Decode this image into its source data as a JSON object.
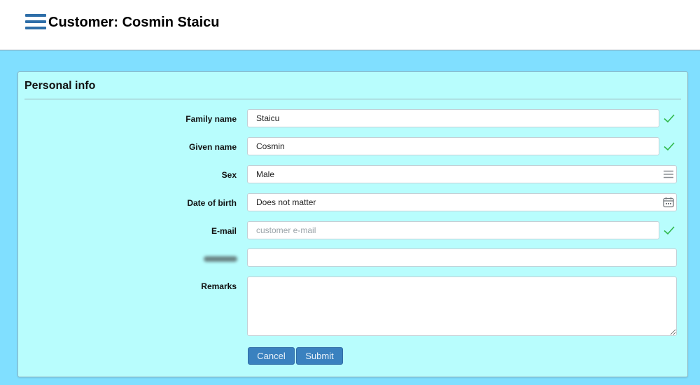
{
  "header": {
    "title": "Customer: Cosmin Staicu"
  },
  "panel": {
    "title": "Personal info"
  },
  "form": {
    "family_name": {
      "label": "Family name",
      "value": "Staicu"
    },
    "given_name": {
      "label": "Given name",
      "value": "Cosmin"
    },
    "sex": {
      "label": "Sex",
      "value": "Male"
    },
    "date_of_birth": {
      "label": "Date of birth",
      "value": "Does not matter"
    },
    "email": {
      "label": "E-mail",
      "value": "",
      "placeholder": "customer e-mail"
    },
    "redacted_field": {
      "value": ""
    },
    "remarks": {
      "label": "Remarks",
      "value": ""
    }
  },
  "buttons": {
    "cancel": "Cancel",
    "submit": "Submit"
  },
  "colors": {
    "page_background": "#80dfff",
    "panel_background": "#b8fdfd",
    "button": "#3a81bf",
    "valid_check": "#2fb84a",
    "menu_icon": "#2e6ea8"
  },
  "icons": {
    "menu": "hamburger-icon",
    "valid": "checkmark-icon",
    "select": "list-icon",
    "date": "calendar-icon"
  }
}
